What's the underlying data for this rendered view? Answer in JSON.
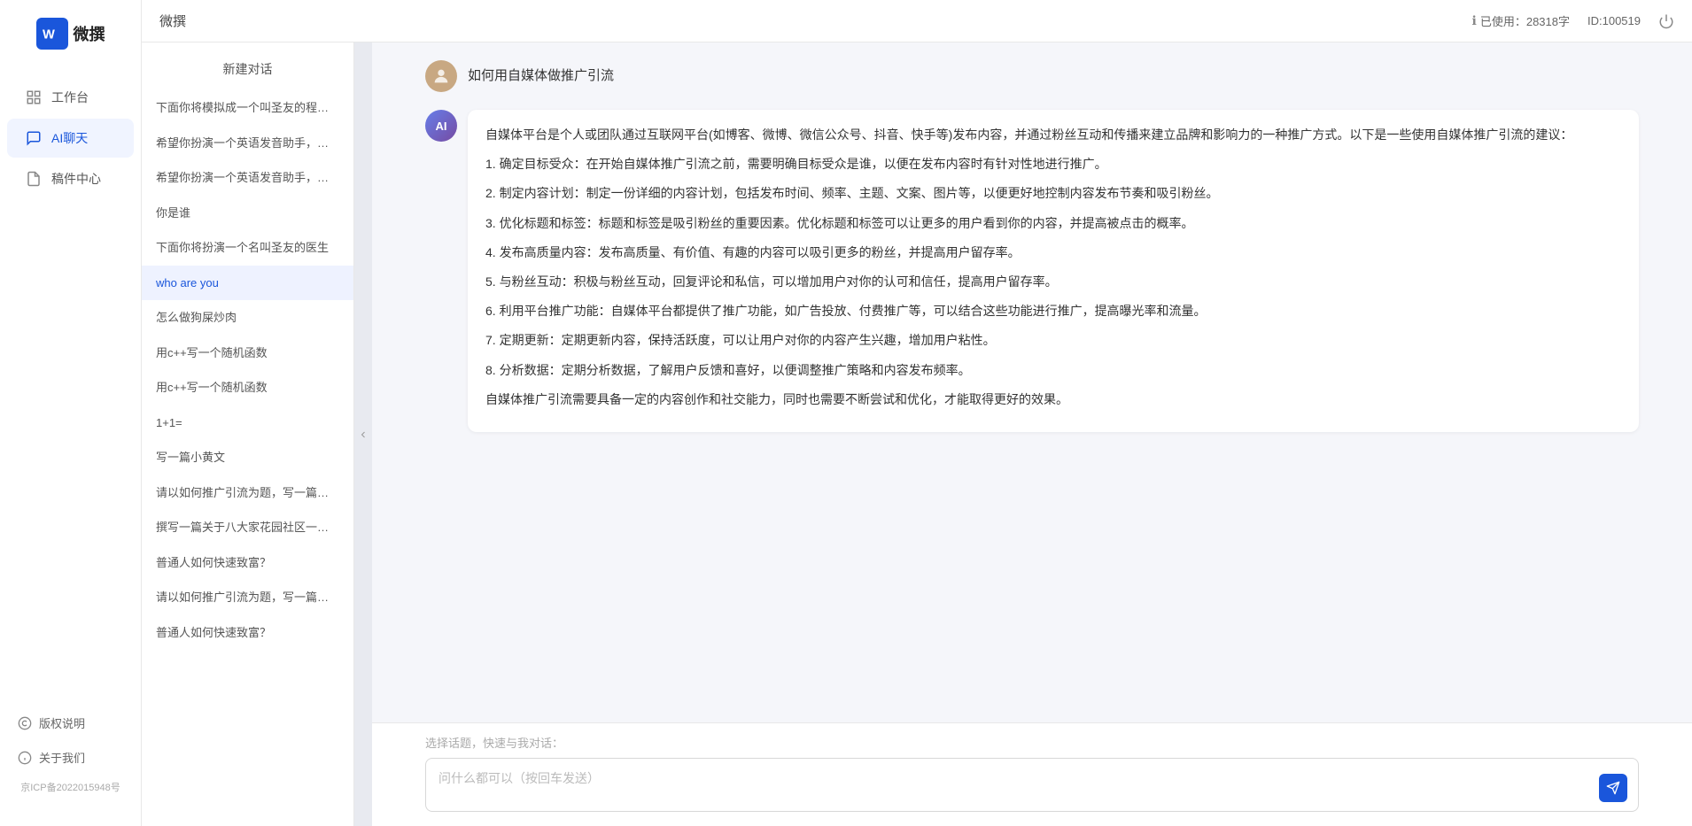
{
  "app": {
    "name": "微撰",
    "title": "微撰",
    "usage_label": "已使用：28318字",
    "id_label": "ID:100519"
  },
  "sidebar": {
    "nav_items": [
      {
        "id": "workbench",
        "label": "工作台",
        "icon": "grid-icon",
        "active": false
      },
      {
        "id": "ai-chat",
        "label": "AI聊天",
        "icon": "chat-icon",
        "active": true
      },
      {
        "id": "draft",
        "label": "稿件中心",
        "icon": "file-icon",
        "active": false
      }
    ],
    "bottom_items": [
      {
        "id": "copyright",
        "label": "版权说明",
        "icon": "copyright-icon"
      },
      {
        "id": "about",
        "label": "关于我们",
        "icon": "info-icon"
      }
    ],
    "icp": "京ICP备2022015948号"
  },
  "chat_list": {
    "new_chat": "新建对话",
    "items": [
      {
        "id": 1,
        "text": "下面你将模拟成一个叫圣友的程序员，我说...",
        "active": false
      },
      {
        "id": 2,
        "text": "希望你扮演一个英语发音助手，我提供给你...",
        "active": false
      },
      {
        "id": 3,
        "text": "希望你扮演一个英语发音助手，我提供给你...",
        "active": false
      },
      {
        "id": 4,
        "text": "你是谁",
        "active": false
      },
      {
        "id": 5,
        "text": "下面你将扮演一个名叫圣友的医生",
        "active": false
      },
      {
        "id": 6,
        "text": "who are you",
        "active": true
      },
      {
        "id": 7,
        "text": "怎么做狗屎炒肉",
        "active": false
      },
      {
        "id": 8,
        "text": "用c++写一个随机函数",
        "active": false
      },
      {
        "id": 9,
        "text": "用c++写一个随机函数",
        "active": false
      },
      {
        "id": 10,
        "text": "1+1=",
        "active": false
      },
      {
        "id": 11,
        "text": "写一篇小黄文",
        "active": false
      },
      {
        "id": 12,
        "text": "请以如何推广引流为题，写一篇大纲",
        "active": false
      },
      {
        "id": 13,
        "text": "撰写一篇关于八大家花园社区一刻钟便民生...",
        "active": false
      },
      {
        "id": 14,
        "text": "普通人如何快速致富？",
        "active": false
      },
      {
        "id": 15,
        "text": "请以如何推广引流为题，写一篇大纲",
        "active": false
      },
      {
        "id": 16,
        "text": "普通人如何快速致富？",
        "active": false
      }
    ]
  },
  "messages": [
    {
      "type": "user",
      "text": "如何用自媒体做推广引流",
      "avatar_color": "#c8a882"
    },
    {
      "type": "ai",
      "content": "自媒体平台是个人或团队通过互联网平台(如博客、微博、微信公众号、抖音、快手等)发布内容，并通过粉丝互动和传播来建立品牌和影响力的一种推广方式。以下是一些使用自媒体推广引流的建议：\n\n1. 确定目标受众：在开始自媒体推广引流之前，需要明确目标受众是谁，以便在发布内容时有针对性地进行推广。\n\n2. 制定内容计划：制定一份详细的内容计划，包括发布时间、频率、主题、文案、图片等，以便更好地控制内容发布节奏和吸引粉丝。\n\n3. 优化标题和标签：标题和标签是吸引粉丝的重要因素。优化标题和标签可以让更多的用户看到你的内容，并提高被点击的概率。\n\n4. 发布高质量内容：发布高质量、有价值、有趣的内容可以吸引更多的粉丝，并提高用户留存率。\n\n5. 与粉丝互动：积极与粉丝互动，回复评论和私信，可以增加用户对你的认可和信任，提高用户留存率。\n\n6. 利用平台推广功能：自媒体平台都提供了推广功能，如广告投放、付费推广等，可以结合这些功能进行推广，提高曝光率和流量。\n\n7. 定期更新：定期更新内容，保持活跃度，可以让用户对你的内容产生兴趣，增加用户粘性。\n\n8. 分析数据：定期分析数据，了解用户反馈和喜好，以便调整推广策略和内容发布频率。\n\n自媒体推广引流需要具备一定的内容创作和社交能力，同时也需要不断尝试和优化，才能取得更好的效果。"
    }
  ],
  "input": {
    "quick_hint": "选择话题，快速与我对话：",
    "placeholder": "问什么都可以（按回车发送）",
    "send_icon": "send-icon"
  }
}
